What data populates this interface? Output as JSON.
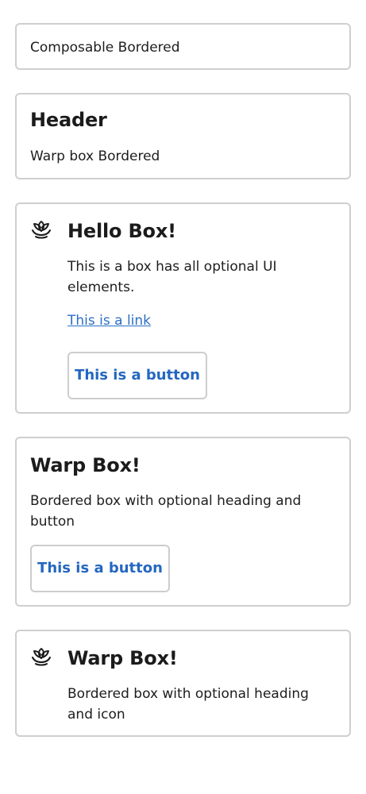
{
  "boxes": [
    {
      "body": "Composable Bordered"
    },
    {
      "heading": "Header",
      "body": "Warp box Bordered"
    },
    {
      "icon": "lotus-icon",
      "heading": "Hello Box!",
      "body": "This is a box has all optional UI elements.",
      "link": "This is a link",
      "button": "This is a button"
    },
    {
      "heading": "Warp Box!",
      "body": "Bordered box with optional heading and button",
      "button": "This is a button"
    },
    {
      "icon": "lotus-icon",
      "heading": "Warp Box!",
      "body": "Bordered box with optional heading and icon"
    }
  ],
  "colors": {
    "border": "#cfcfd1",
    "link": "#2b6fc4",
    "button_text": "#2467c0",
    "text": "#1d1d1f"
  }
}
